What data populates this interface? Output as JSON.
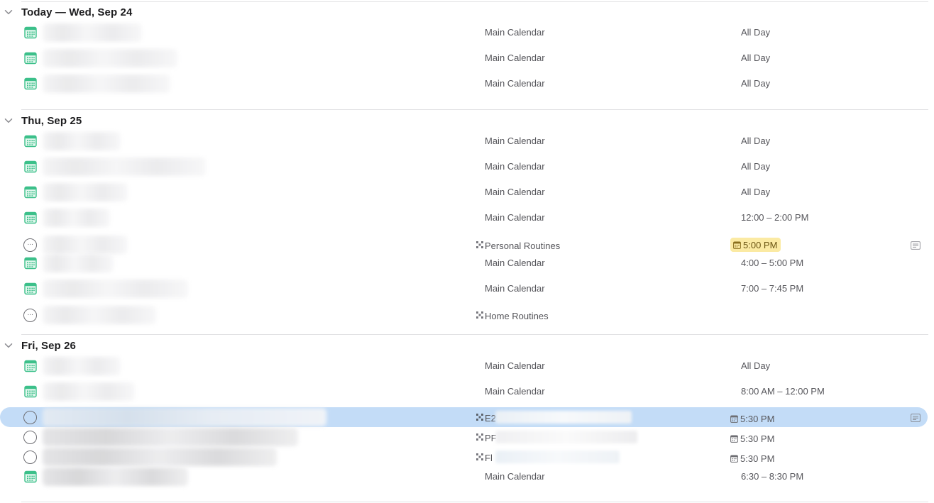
{
  "sections": [
    {
      "title": "Today — Wed, Sep 24",
      "rows": [
        {
          "type": "event",
          "calendar": "Main Calendar",
          "time": "All Day"
        },
        {
          "type": "event",
          "calendar": "Main Calendar",
          "time": "All Day"
        },
        {
          "type": "event",
          "calendar": "Main Calendar",
          "time": "All Day"
        }
      ]
    },
    {
      "title": "Thu, Sep 25",
      "rows": [
        {
          "type": "event",
          "calendar": "Main Calendar",
          "time": "All Day"
        },
        {
          "type": "event",
          "calendar": "Main Calendar",
          "time": "All Day"
        },
        {
          "type": "event",
          "calendar": "Main Calendar",
          "time": "All Day"
        },
        {
          "type": "event",
          "calendar": "Main Calendar",
          "time": "12:00 – 2:00 PM"
        },
        {
          "type": "task",
          "calendar": "Personal Routines",
          "time": "5:00 PM",
          "due_highlight": true,
          "has_note": true
        },
        {
          "type": "event",
          "calendar": "Main Calendar",
          "time": "4:00 – 5:00 PM"
        },
        {
          "type": "event",
          "calendar": "Main Calendar",
          "time": "7:00 – 7:45 PM"
        },
        {
          "type": "task",
          "calendar": "Home Routines",
          "time": ""
        }
      ]
    },
    {
      "title": "Fri, Sep 26",
      "rows": [
        {
          "type": "event",
          "calendar": "Main Calendar",
          "time": "All Day"
        },
        {
          "type": "event",
          "calendar": "Main Calendar",
          "time": "8:00 AM – 12:00 PM"
        },
        {
          "type": "task",
          "calendar": "E2",
          "time": "5:30 PM",
          "selected": true,
          "has_note": true
        },
        {
          "type": "task",
          "calendar": "PF",
          "time": "5:30 PM"
        },
        {
          "type": "task",
          "calendar": "Fl",
          "time": "5:30 PM"
        },
        {
          "type": "event",
          "calendar": "Main Calendar",
          "time": "6:30 – 8:30 PM"
        }
      ]
    }
  ],
  "colors": {
    "calendar_icon": "#3cc08a",
    "selection": "#c3dcf7",
    "due_highlight": "#fbeaa3",
    "divider": "#e2e2e4"
  }
}
